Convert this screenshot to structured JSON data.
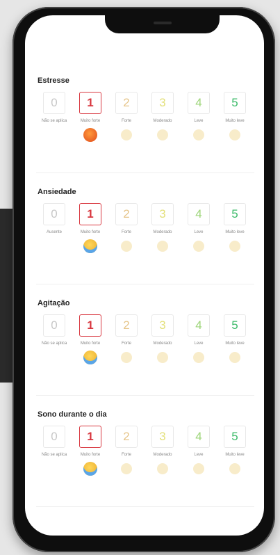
{
  "colors": {
    "level0": "#c7c7c7",
    "level1": "#d8373f",
    "level2": "#e6c58a",
    "level3": "#e3e07a",
    "level4": "#9ed57a",
    "level5": "#3dbb6a"
  },
  "sections": [
    {
      "title": "Estresse",
      "selected": 1,
      "options": [
        {
          "value": "0",
          "caption": "Não se aplica"
        },
        {
          "value": "1",
          "caption": "Muito forte"
        },
        {
          "value": "2",
          "caption": "Forte"
        },
        {
          "value": "3",
          "caption": "Moderado"
        },
        {
          "value": "4",
          "caption": "Leve"
        },
        {
          "value": "5",
          "caption": "Muito leve"
        }
      ],
      "selected_emoji": "angry-face-icon"
    },
    {
      "title": "Ansiedade",
      "selected": 1,
      "options": [
        {
          "value": "0",
          "caption": "Ausente"
        },
        {
          "value": "1",
          "caption": "Muito forte"
        },
        {
          "value": "2",
          "caption": "Forte"
        },
        {
          "value": "3",
          "caption": "Moderado"
        },
        {
          "value": "4",
          "caption": "Leve"
        },
        {
          "value": "5",
          "caption": "Muito leve"
        }
      ],
      "selected_emoji": "crying-face-icon"
    },
    {
      "title": "Agitação",
      "selected": 1,
      "options": [
        {
          "value": "0",
          "caption": "Não se aplica"
        },
        {
          "value": "1",
          "caption": "Muito forte"
        },
        {
          "value": "2",
          "caption": "Forte"
        },
        {
          "value": "3",
          "caption": "Moderado"
        },
        {
          "value": "4",
          "caption": "Leve"
        },
        {
          "value": "5",
          "caption": "Muito leve"
        }
      ],
      "selected_emoji": "crying-face-icon"
    },
    {
      "title": "Sono durante o dia",
      "selected": 1,
      "options": [
        {
          "value": "0",
          "caption": "Não se aplica"
        },
        {
          "value": "1",
          "caption": "Muito forte"
        },
        {
          "value": "2",
          "caption": "Forte"
        },
        {
          "value": "3",
          "caption": "Moderado"
        },
        {
          "value": "4",
          "caption": "Leve"
        },
        {
          "value": "5",
          "caption": "Muito leve"
        }
      ],
      "selected_emoji": "crying-face-icon"
    }
  ]
}
